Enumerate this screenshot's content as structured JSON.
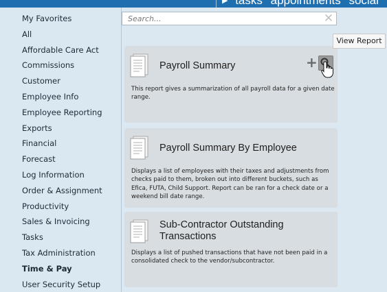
{
  "topnav": {
    "items": [
      "tasks",
      "appointments",
      "social"
    ]
  },
  "sidebar": {
    "items": [
      {
        "label": "My Favorites",
        "active": false
      },
      {
        "label": "All",
        "active": false
      },
      {
        "label": "Affordable Care Act",
        "active": false
      },
      {
        "label": "Commissions",
        "active": false
      },
      {
        "label": "Customer",
        "active": false
      },
      {
        "label": "Employee Info",
        "active": false
      },
      {
        "label": "Employee Reporting",
        "active": false
      },
      {
        "label": "Exports",
        "active": false
      },
      {
        "label": "Financial",
        "active": false
      },
      {
        "label": "Forecast",
        "active": false
      },
      {
        "label": "Log Information",
        "active": false
      },
      {
        "label": "Order & Assignment",
        "active": false
      },
      {
        "label": "Productivity",
        "active": false
      },
      {
        "label": "Sales & Invoicing",
        "active": false
      },
      {
        "label": "Tasks",
        "active": false
      },
      {
        "label": "Tax Administration",
        "active": false
      },
      {
        "label": "Time & Pay",
        "active": true
      },
      {
        "label": "User Security Setup",
        "active": false
      }
    ]
  },
  "search": {
    "placeholder": "Search...",
    "value": ""
  },
  "tooltip": {
    "text": "View Report"
  },
  "reports": [
    {
      "title": "Payroll Summary",
      "description": "This report gives a summarization of all payroll data for a given date range."
    },
    {
      "title": "Payroll Summary By Employee",
      "description": "Displays a list of employees with their taxes and adjustments from checks paid to them, broken out into different buckets, such as Efica, FUTA, Child Support.  Report can be ran for a check date or a weekend bill date range."
    },
    {
      "title": "Sub-Contractor Outstanding Transactions",
      "description": "Displays a list of pushed transactions that have not been paid in a consolidated check to the vendor/subcontractor."
    }
  ],
  "colors": {
    "topbar": "#1f6fb0",
    "background": "#d9e8f1",
    "card": "#d8dde1"
  }
}
